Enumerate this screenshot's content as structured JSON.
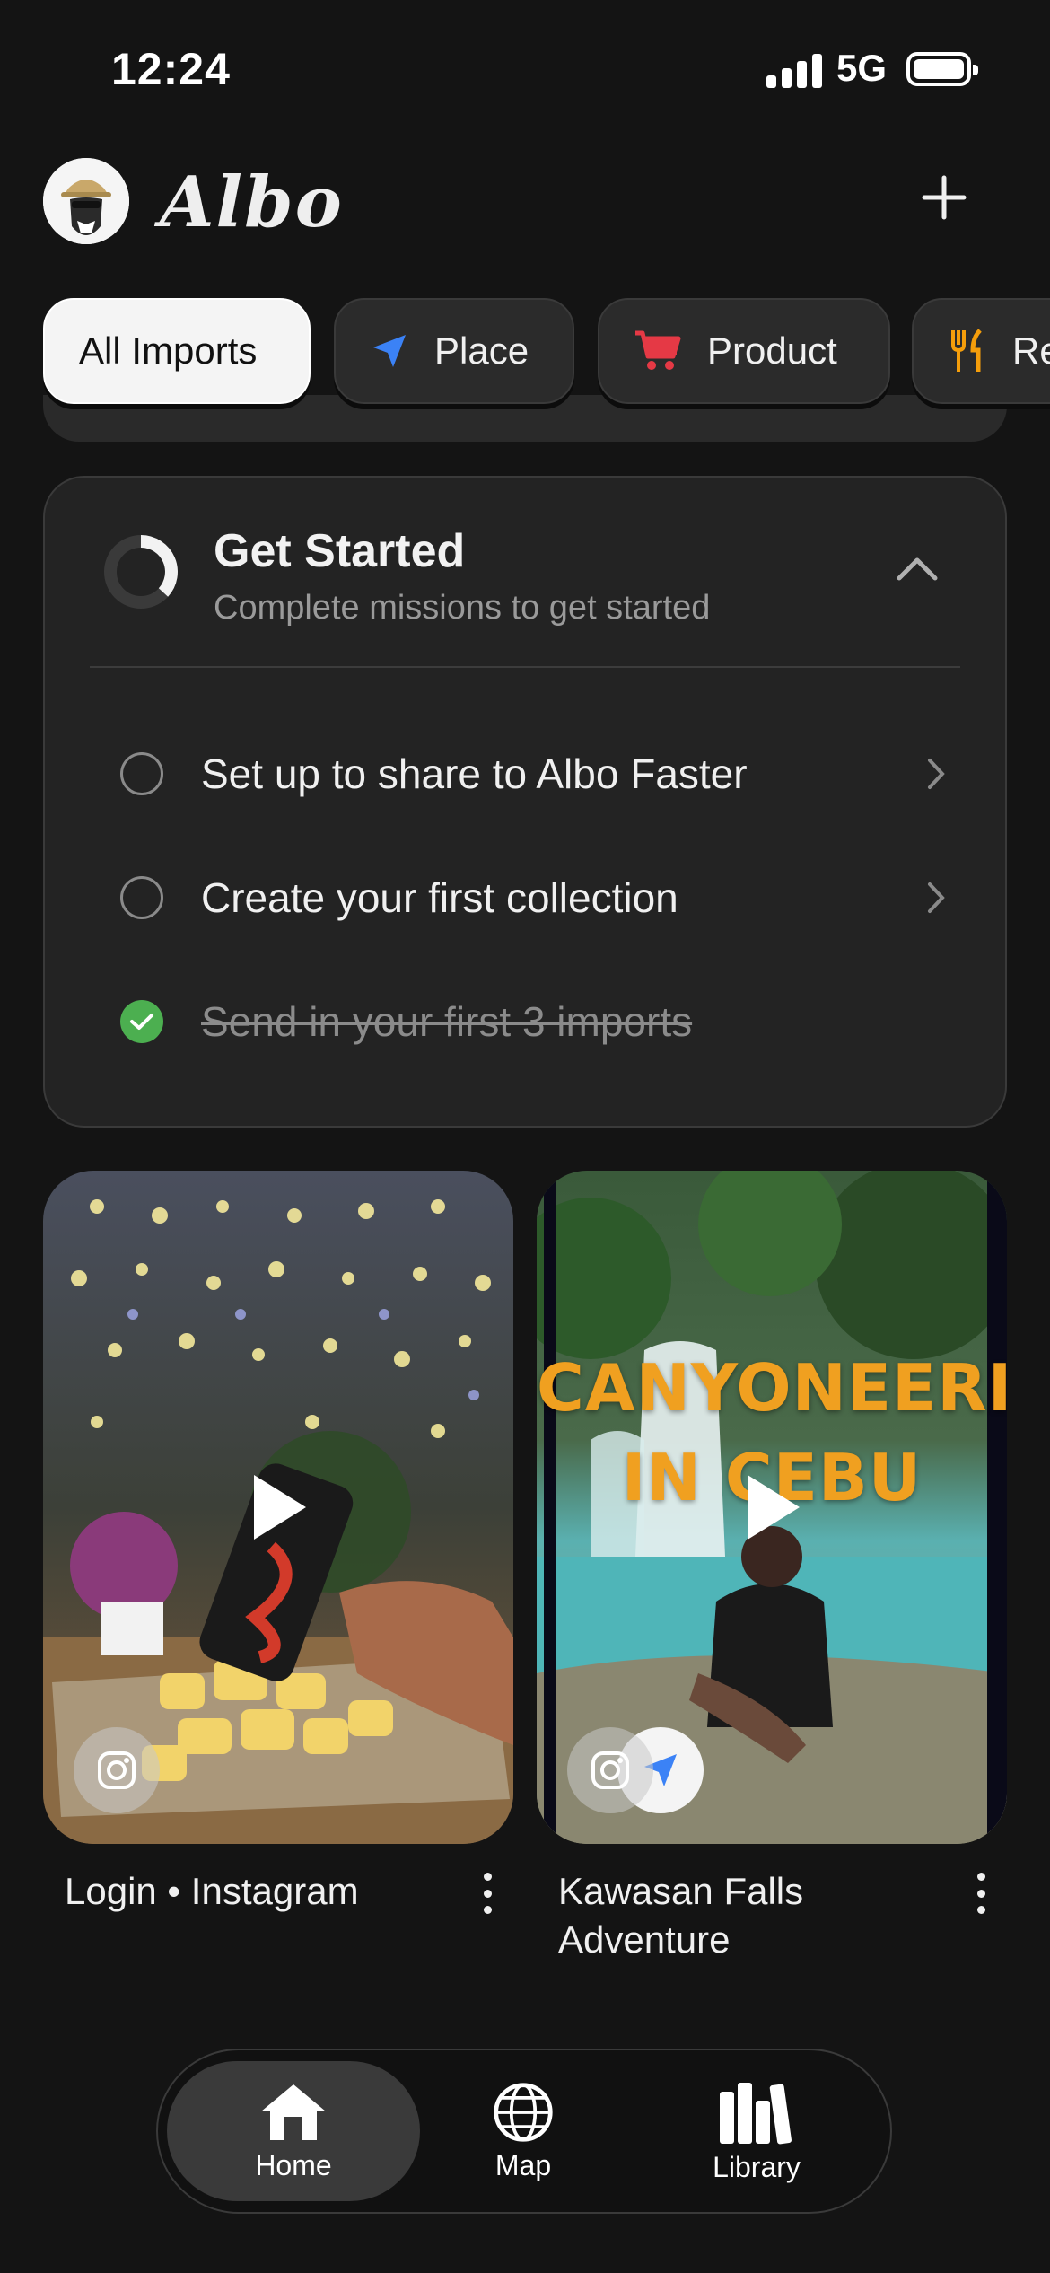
{
  "status_bar": {
    "time": "12:24",
    "network": "5G"
  },
  "header": {
    "app_name": "Albo"
  },
  "filters": [
    {
      "label": "All Imports",
      "icon": "none",
      "active": true
    },
    {
      "label": "Place",
      "icon": "navigation-arrow-icon",
      "color": "#3b82f6"
    },
    {
      "label": "Product",
      "icon": "shopping-cart-icon",
      "color": "#e53945"
    },
    {
      "label": "Re",
      "icon": "fork-knife-icon",
      "color": "#f59e0b"
    }
  ],
  "get_started": {
    "title": "Get Started",
    "subtitle": "Complete missions to get started",
    "tasks": [
      {
        "label": "Set up to share to Albo Faster",
        "done": false
      },
      {
        "label": "Create your first collection",
        "done": false
      },
      {
        "label": "Send in your first 3 imports",
        "done": true
      }
    ]
  },
  "imports": [
    {
      "caption": "Login • Instagram",
      "source": "instagram-icon"
    },
    {
      "caption": "Kawasan Falls Adventure",
      "overlay_text_1": "CANYONEERING",
      "overlay_text_2": "IN CEBU",
      "source": "instagram-icon",
      "type": "place"
    }
  ],
  "tabs": [
    {
      "label": "Home",
      "icon": "home-icon",
      "active": true
    },
    {
      "label": "Map",
      "icon": "globe-icon"
    },
    {
      "label": "Library",
      "icon": "library-icon"
    }
  ]
}
